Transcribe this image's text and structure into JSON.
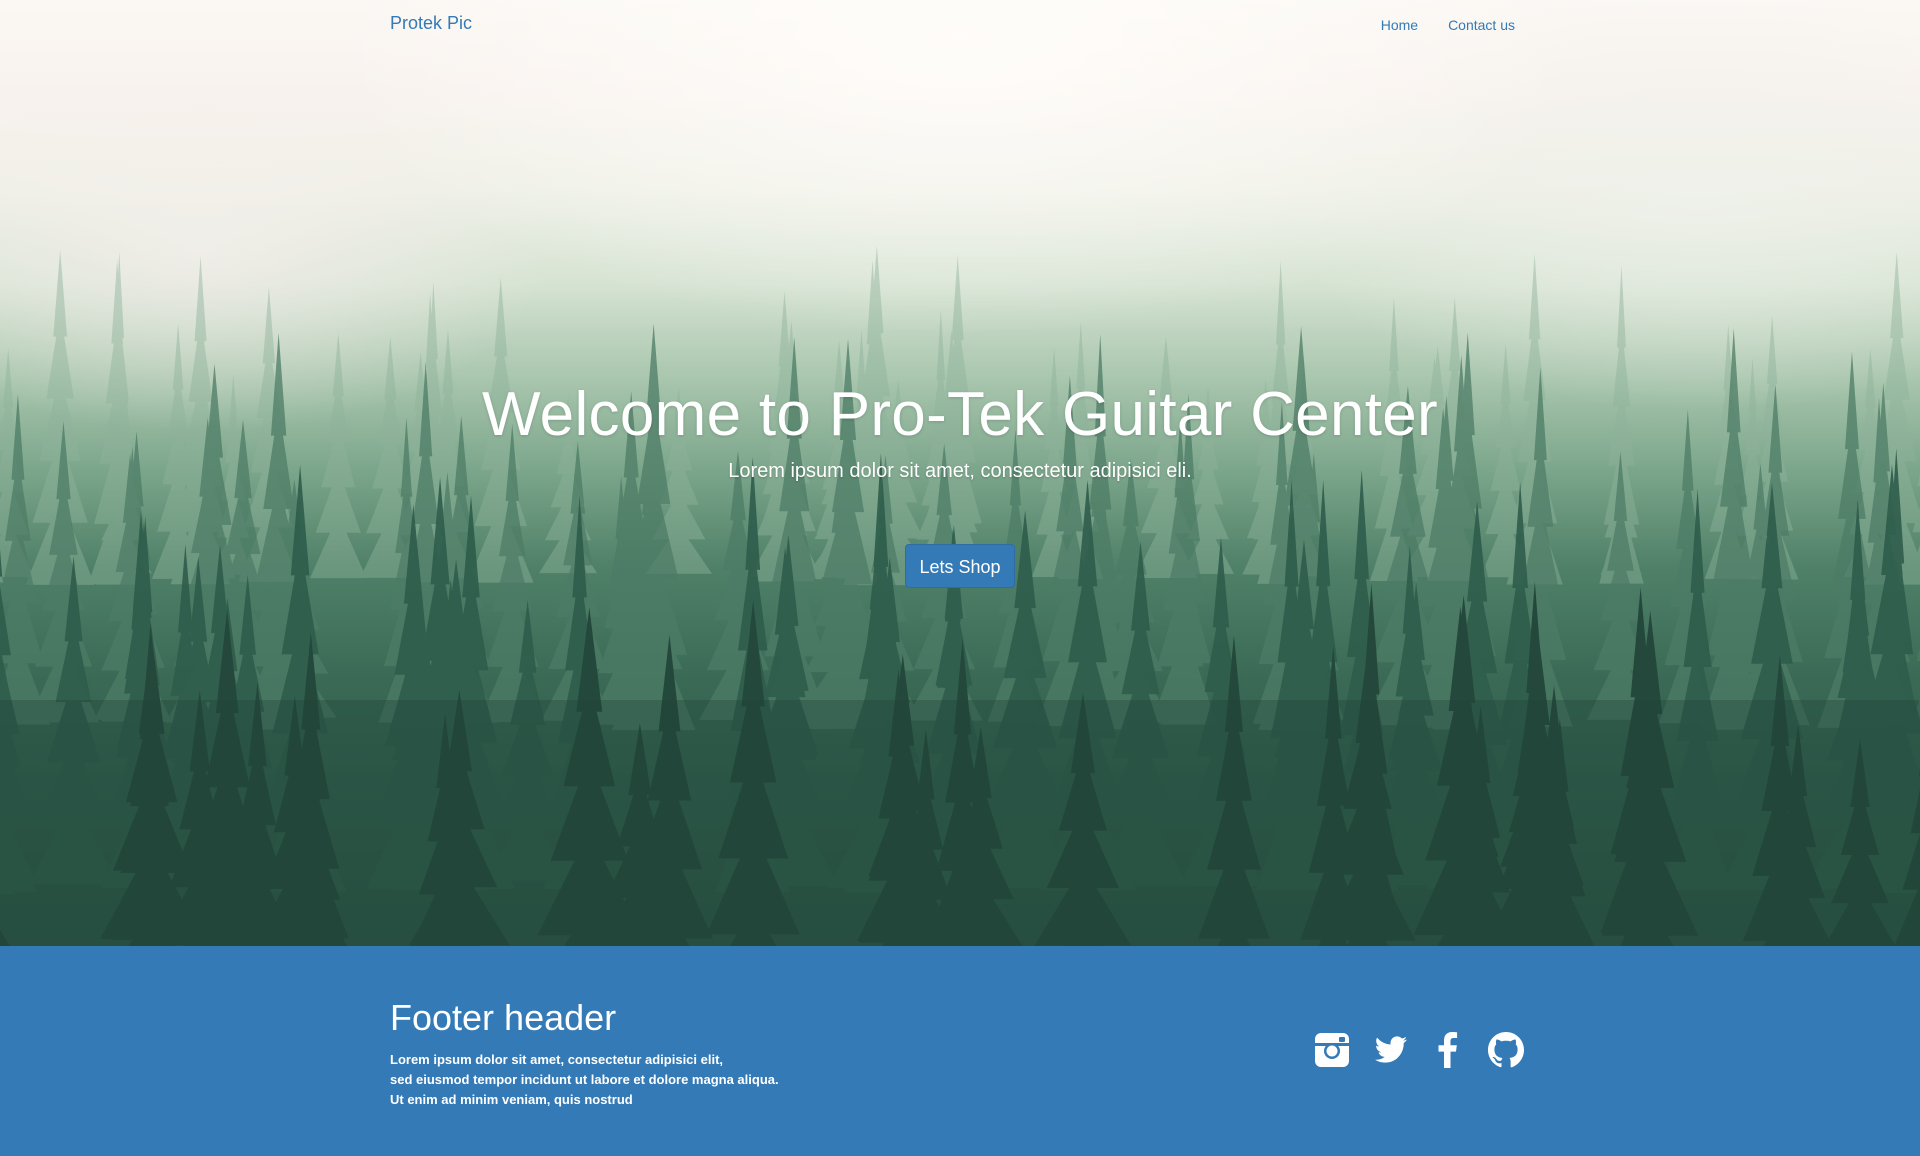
{
  "nav": {
    "brand": "Protek Pic",
    "links": [
      {
        "label": "Home"
      },
      {
        "label": "Contact us"
      }
    ]
  },
  "hero": {
    "title": "Welcome to Pro-Tek Guitar Center",
    "subtitle": "Lorem ipsum dolor sit amet, consectetur adipisici eli.",
    "cta_label": "Lets Shop"
  },
  "footer": {
    "header": "Footer header",
    "lines": [
      "Lorem ipsum dolor sit amet, consectetur adipisici elit,",
      "sed eiusmod tempor incidunt ut labore et dolore magna aliqua.",
      "Ut enim ad minim veniam, quis nostrud"
    ],
    "social_icons": [
      "instagram-icon",
      "twitter-icon",
      "facebook-icon",
      "github-icon"
    ]
  },
  "colors": {
    "primary": "#337ab7",
    "text_on_primary": "#ffffff",
    "forest_dark": "#2b5546",
    "mist": "#fbf8f4"
  }
}
